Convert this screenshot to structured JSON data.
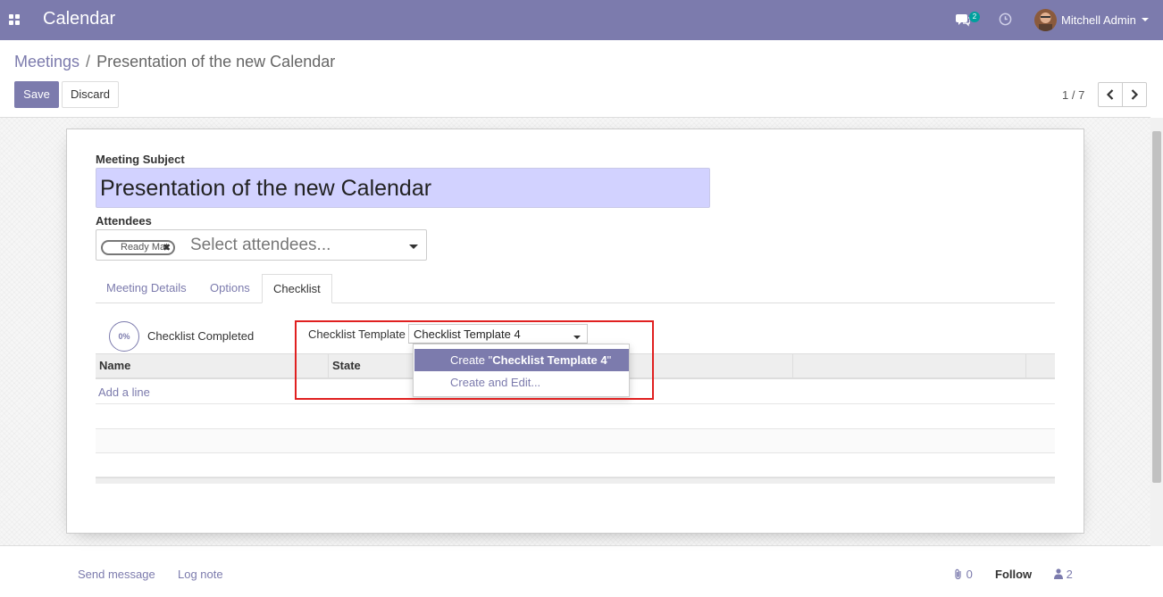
{
  "navbar": {
    "app_title": "Calendar",
    "chat_badge": "2",
    "user_name": "Mitchell Admin"
  },
  "breadcrumb": {
    "parent": "Meetings",
    "separator": "/",
    "current": "Presentation of the new Calendar"
  },
  "toolbar": {
    "save_label": "Save",
    "discard_label": "Discard",
    "pager": "1 / 7"
  },
  "form": {
    "subject_label": "Meeting Subject",
    "subject_value": "Presentation of the new Calendar",
    "attendees_label": "Attendees",
    "attendee_tag": "Ready Mat",
    "attendees_placeholder": "Select attendees..."
  },
  "tabs": [
    {
      "label": "Meeting Details",
      "active": false
    },
    {
      "label": "Options",
      "active": false
    },
    {
      "label": "Checklist",
      "active": true
    }
  ],
  "checklist": {
    "progress": "0%",
    "progress_value": 0,
    "completed_label": "Checklist Completed",
    "template_label": "Checklist Template",
    "template_value": "Checklist Template 4",
    "columns": [
      "Name",
      "State"
    ],
    "add_line": "Add a line"
  },
  "dropdown": {
    "create_prefix": "Create \"",
    "create_value": "Checklist Template 4",
    "create_suffix": "\"",
    "create_edit": "Create and Edit..."
  },
  "chatter": {
    "send_message": "Send message",
    "log_note": "Log note",
    "attachments": "0",
    "follow": "Follow",
    "followers": "2"
  },
  "colors": {
    "brand": "#7c7bad",
    "subject_bg": "#d2d2ff",
    "highlight": "#e02020",
    "badge": "#00a09d"
  }
}
